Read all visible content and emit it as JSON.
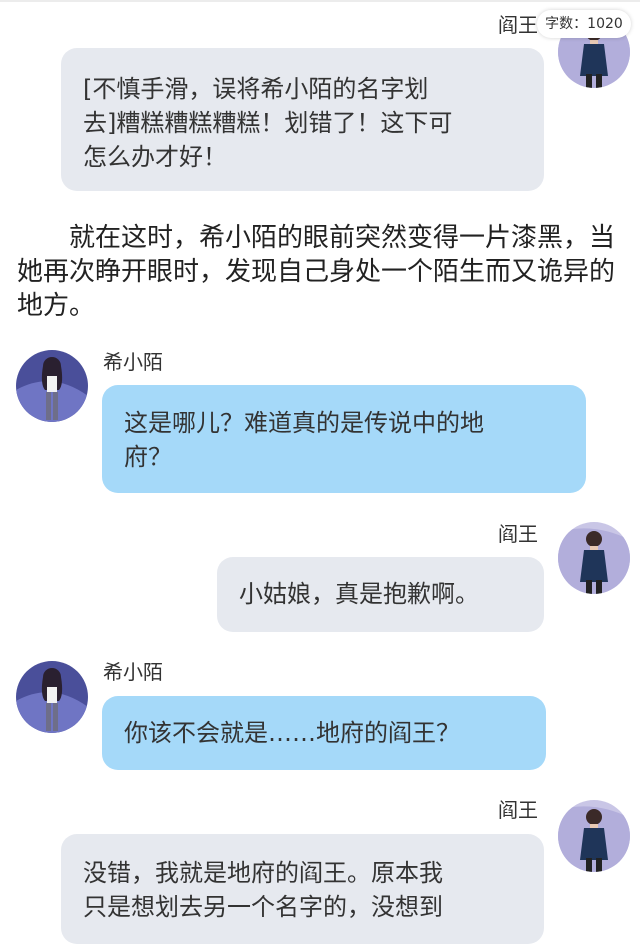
{
  "wordcount": "字数：1020",
  "messages": [
    {
      "speaker": "阎王",
      "side": "right",
      "lines": [
        "[不慎手滑，误将希小陌的名字划",
        "去]糟糕糟糕糟糕！划错了！这下可",
        "怎么办才好！"
      ]
    },
    {
      "type": "narration",
      "text": "就在这时，希小陌的眼前突然变得一片漆黑，当她再次睁开眼时，发现自己身处一个陌生而又诡异的地方。"
    },
    {
      "speaker": "希小陌",
      "side": "left",
      "lines": [
        "这是哪儿？难道真的是传说中的地",
        "府？"
      ]
    },
    {
      "speaker": "阎王",
      "side": "right",
      "lines": [
        "小姑娘，真是抱歉啊。"
      ]
    },
    {
      "speaker": "希小陌",
      "side": "left",
      "lines": [
        "你该不会就是……地府的阎王？"
      ]
    },
    {
      "speaker": "阎王",
      "side": "right",
      "lines": [
        "没错，我就是地府的阎王。原本我",
        "只是想划去另一个名字的，没想到"
      ]
    }
  ],
  "avatar_icons": {
    "yanwang": "yanwang-avatar-icon",
    "xixiaomo": "xixiaomo-avatar-icon"
  },
  "colors": {
    "right_bubble": "#e6e9ef",
    "left_bubble": "#a5d9f9",
    "background": "#ffffff"
  }
}
